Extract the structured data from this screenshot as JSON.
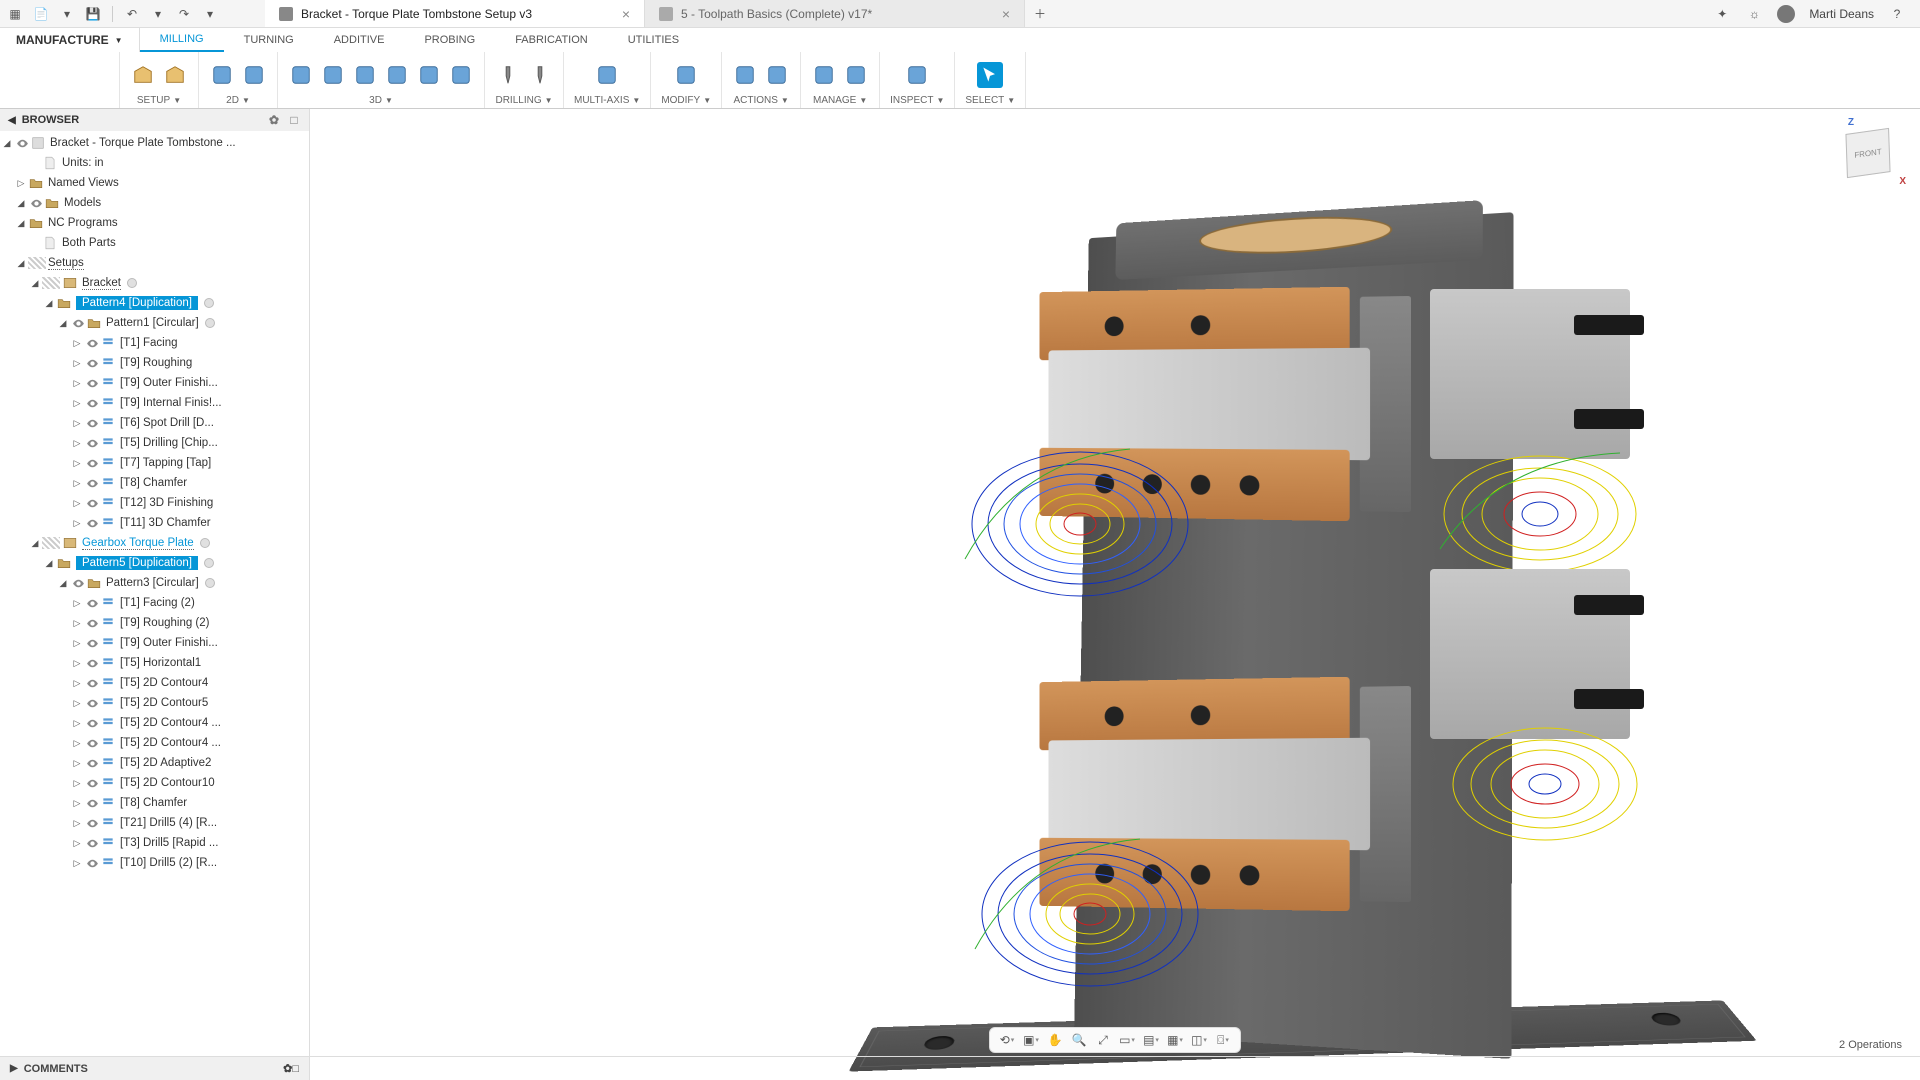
{
  "titlebar": {
    "tabs": [
      {
        "title": "Bracket - Torque Plate Tombstone Setup v3",
        "active": true
      },
      {
        "title": "5 - Toolpath Basics (Complete) v17*",
        "active": false
      }
    ],
    "user": "Marti Deans"
  },
  "workspace": "MANUFACTURE",
  "ribbon_tabs": [
    "MILLING",
    "TURNING",
    "ADDITIVE",
    "PROBING",
    "FABRICATION",
    "UTILITIES"
  ],
  "ribbon_active": "MILLING",
  "groups": [
    {
      "label": "SETUP",
      "icons": 2,
      "dropdown": true
    },
    {
      "label": "2D",
      "icons": 2,
      "dropdown": true
    },
    {
      "label": "3D",
      "icons": 6,
      "dropdown": true
    },
    {
      "label": "DRILLING",
      "icons": 2,
      "dropdown": true
    },
    {
      "label": "MULTI-AXIS",
      "icons": 1,
      "dropdown": true
    },
    {
      "label": "MODIFY",
      "icons": 1,
      "dropdown": true
    },
    {
      "label": "ACTIONS",
      "icons": 2,
      "dropdown": true
    },
    {
      "label": "MANAGE",
      "icons": 2,
      "dropdown": true
    },
    {
      "label": "INSPECT",
      "icons": 1,
      "dropdown": true
    },
    {
      "label": "SELECT",
      "icons": 1,
      "dropdown": true,
      "selected": true
    }
  ],
  "browser": {
    "title": "BROWSER",
    "root": "Bracket - Torque Plate Tombstone ...",
    "top_nodes": [
      {
        "label": "Units: in",
        "indent": 2,
        "twisty": "",
        "icon": "doc"
      },
      {
        "label": "Named Views",
        "indent": 1,
        "twisty": "▷",
        "icon": "folder"
      },
      {
        "label": "Models",
        "indent": 1,
        "twisty": "◢",
        "eye": true,
        "icon": "folder"
      },
      {
        "label": "NC Programs",
        "indent": 1,
        "twisty": "◢",
        "icon": "folder"
      },
      {
        "label": "Both Parts",
        "indent": 2,
        "twisty": "",
        "icon": "doc"
      }
    ],
    "setups_label": "Setups",
    "bracket_label": "Bracket",
    "pattern4_label": "Pattern4 [Duplication]",
    "pattern1_label": "Pattern1 [Circular]",
    "ops1": [
      "[T1] Facing",
      "[T9] Roughing",
      "[T9] Outer Finishi...",
      "[T9] Internal Finis!...",
      "[T6] Spot Drill [D...",
      "[T5] Drilling [Chip...",
      "[T7] Tapping [Tap]",
      "[T8] Chamfer",
      "[T12] 3D Finishing",
      "[T11] 3D Chamfer"
    ],
    "gearbox_label": "Gearbox Torque Plate",
    "pattern5_label": "Pattern5 [Duplication]",
    "pattern3_label": "Pattern3 [Circular]",
    "ops2": [
      "[T1] Facing (2)",
      "[T9] Roughing (2)",
      "[T9] Outer Finishi...",
      "[T5] Horizontal1",
      "[T5] 2D Contour4",
      "[T5] 2D Contour5",
      "[T5] 2D Contour4 ...",
      "[T5] 2D Contour4 ...",
      "[T5] 2D Adaptive2",
      "[T5] 2D Contour10",
      "[T8] Chamfer",
      "[T21] Drill5 (4) [R...",
      "[T3] Drill5 [Rapid ...",
      "[T10] Drill5 (2) [R..."
    ]
  },
  "comments_label": "COMMENTS",
  "status": "2 Operations",
  "viewcube": {
    "face": "FRONT",
    "z": "Z",
    "x": "X"
  }
}
